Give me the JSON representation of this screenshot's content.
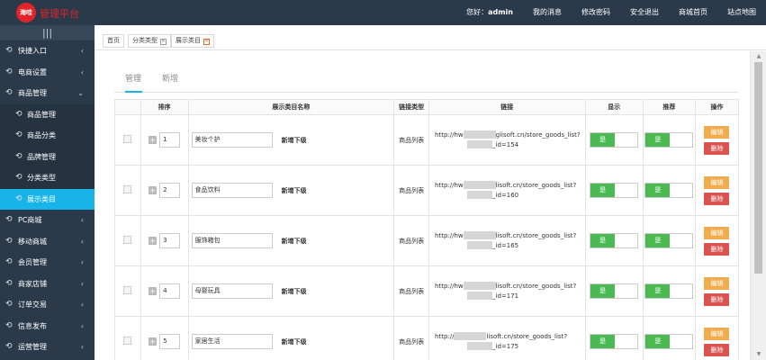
{
  "header": {
    "logo_badge": "海哇",
    "logo_text": "管理平台",
    "nav": [
      {
        "prefix": "您好：",
        "strong": "admin"
      },
      {
        "label": "我的消息"
      },
      {
        "label": "修改密码"
      },
      {
        "label": "安全退出"
      },
      {
        "label": "商城首页"
      },
      {
        "label": "站点地图"
      }
    ]
  },
  "sidebar": {
    "toggle": "|||",
    "items": [
      {
        "label": "快捷入口",
        "chev": "‹",
        "ic": "⟲"
      },
      {
        "label": "电商设置",
        "chev": "‹",
        "ic": "⟲"
      },
      {
        "label": "商品管理",
        "chev": "⌄",
        "ic": "⟲"
      },
      {
        "label": "商品管理",
        "sub": true,
        "ic": "⟲"
      },
      {
        "label": "商品分类",
        "sub": true,
        "ic": "⟲"
      },
      {
        "label": "品牌管理",
        "sub": true,
        "ic": "⟲"
      },
      {
        "label": "分类类型",
        "sub": true,
        "ic": "⟲"
      },
      {
        "label": "展示类目",
        "sub": true,
        "active": true,
        "ic": "⟲"
      },
      {
        "label": "PC商城",
        "chev": "‹",
        "ic": "⟲"
      },
      {
        "label": "移动商城",
        "chev": "‹",
        "ic": "⟲"
      },
      {
        "label": "会员管理",
        "chev": "‹",
        "ic": "⟲"
      },
      {
        "label": "商家店铺",
        "chev": "‹",
        "ic": "⟲"
      },
      {
        "label": "订单交易",
        "chev": "‹",
        "ic": "⟲"
      },
      {
        "label": "信息发布",
        "chev": "‹",
        "ic": "⟲"
      },
      {
        "label": "运营管理",
        "chev": "‹",
        "ic": "⟲"
      }
    ]
  },
  "page_tabs": [
    {
      "label": "首页"
    },
    {
      "label": "分类类型",
      "closable": true
    },
    {
      "label": "展示类目",
      "closable": true,
      "active": true
    }
  ],
  "content_tabs": [
    {
      "label": "管理",
      "active": true
    },
    {
      "label": "新增"
    }
  ],
  "table": {
    "headers": [
      "",
      "排序",
      "展示类目名称",
      "链接类型",
      "链接",
      "显示",
      "推荐",
      "操作"
    ],
    "add_sub_label": "新增下级",
    "on_label": "是",
    "edit_label": "编辑",
    "delete_label": "删除",
    "rows": [
      {
        "sort": "1",
        "name": "美妆个护",
        "link_type": "商品列表",
        "link_prefix": "http://hw",
        "link_mid": "glisoft.cn/store_goods_list?",
        "link_suffix": "_id=154"
      },
      {
        "sort": "2",
        "name": "食品饮料",
        "link_type": "商品列表",
        "link_prefix": "http://hw",
        "link_mid": "lisoft.cn/store_goods_list?",
        "link_suffix": "_id=160"
      },
      {
        "sort": "3",
        "name": "服饰箱包",
        "link_type": "商品列表",
        "link_prefix": "http://hw",
        "link_mid": "lisoft.cn/store_goods_list?",
        "link_suffix": "_id=165"
      },
      {
        "sort": "4",
        "name": "母婴玩具",
        "link_type": "商品列表",
        "link_prefix": "http://hw",
        "link_mid": "lisoft.cn/store_goods_list?",
        "link_suffix": "_id=171"
      },
      {
        "sort": "5",
        "name": "家居生活",
        "link_type": "商品列表",
        "link_prefix": "http://",
        "link_mid": "lisoft.cn/store_goods_list?",
        "link_suffix": "_id=175"
      }
    ]
  },
  "colors": {
    "accent": "#18b4e9",
    "topbar": "#2b3a4a",
    "on": "#4cba52",
    "edit": "#f0ad4e",
    "delete": "#d9534f",
    "logo": "#e2232a"
  }
}
